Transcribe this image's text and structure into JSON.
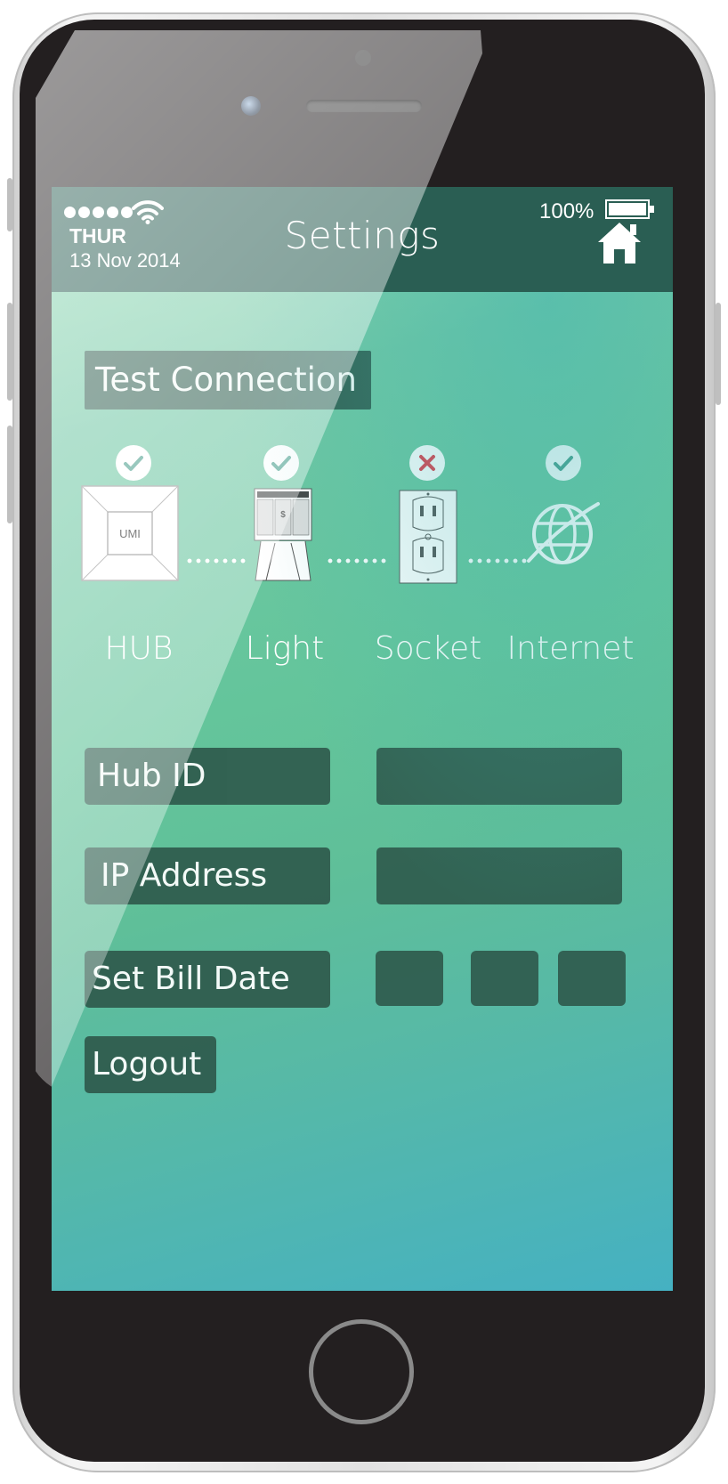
{
  "status_bar": {
    "signal_dots": 5,
    "day": "THUR",
    "date": "13 Nov 2014",
    "battery_percent": "100%",
    "battery_level": 1.0
  },
  "header": {
    "title": "Settings"
  },
  "test_connection": {
    "label": "Test Connection"
  },
  "devices": [
    {
      "label": "HUB",
      "icon": "hub-icon",
      "hub_text": "UMI",
      "status": "ok"
    },
    {
      "label": "Light",
      "icon": "light-device-icon",
      "status": "ok"
    },
    {
      "label": "Socket",
      "icon": "socket-icon",
      "status": "error"
    },
    {
      "label": "Internet",
      "icon": "globe-icon",
      "status": "ok"
    }
  ],
  "fields": {
    "hub_id_label": "Hub ID",
    "hub_id_value": "",
    "ip_address_label": "IP Address",
    "ip_address_value": "",
    "bill_date_label": "Set Bill Date",
    "bill_date_parts": [
      "",
      "",
      ""
    ]
  },
  "logout": {
    "label": "Logout"
  },
  "colors": {
    "status_bar": "#2a5e53",
    "dark_button": "#2f5b4d",
    "check_ok": "#4a9e8c",
    "check_error": "#e23d4b"
  }
}
